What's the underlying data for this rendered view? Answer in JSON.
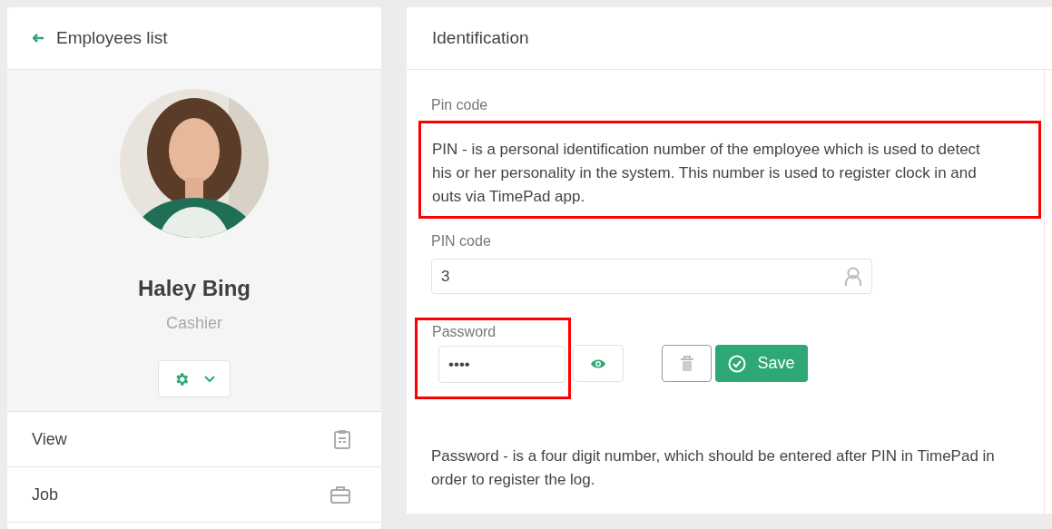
{
  "back_link": {
    "label": "Employees list"
  },
  "profile": {
    "name": "Haley Bing",
    "role": "Cashier"
  },
  "menu": [
    {
      "label": "View",
      "kind": "view"
    },
    {
      "label": "Job",
      "kind": "job"
    }
  ],
  "section": {
    "title": "Identification",
    "subtitle": "Pin code",
    "pin_info": {
      "text": "PIN - is a personal identification number of the employee which is used to detect his or her personality in the system. This number is used to register clock in and outs via TimePad app.",
      "highlighted": true
    },
    "pin_field": {
      "label": "PIN code",
      "value": "3"
    },
    "password_field": {
      "label": "Password",
      "value": "••••",
      "highlighted": true
    },
    "save_button": {
      "label": "Save"
    },
    "password_info": "Password - is a four digit number, which should be entered after PIN in TimePad in order to register the log."
  }
}
